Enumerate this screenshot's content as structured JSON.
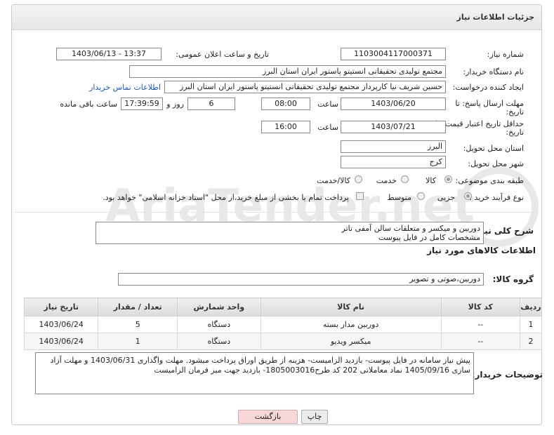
{
  "panel": {
    "title": "جزئیات اطلاعات نیاز"
  },
  "fields": {
    "need_number": {
      "label": "شماره نیاز:",
      "value": "1103004117000371"
    },
    "announce_datetime": {
      "label": "تاریخ و ساعت اعلان عمومی:",
      "value": "1403/06/13 - 13:37"
    },
    "buyer_org": {
      "label": "نام دستگاه خریدار:",
      "value": "مجتمع تولیدی تحقیقاتی انستیتو پاستور ایران استان البرز"
    },
    "requester": {
      "label": "ایجاد کننده درخواست:",
      "value": "حسین شریف نیا کارپرداز مجتمع تولیدی تحقیقاتی انستیتو پاستور ایران استان البرز",
      "contact_link": "اطلاعات تماس خریدار"
    },
    "reply_deadline": {
      "label": "مهلت ارسال پاسخ: تا تاریخ:",
      "date": "1403/06/20",
      "time_label": "ساعت",
      "time": "08:00",
      "days": "6",
      "days_label": "روز و",
      "remaining": "17:39:59",
      "remaining_label": "ساعت باقی مانده"
    },
    "price_validity": {
      "label": "حداقل تاریخ اعتبار قیمت: تا تاریخ:",
      "date": "1403/07/21",
      "time_label": "ساعت",
      "time": "16:00"
    },
    "province": {
      "label": "استان محل تحویل:",
      "value": "البرز"
    },
    "city": {
      "label": "شهر محل تحویل:",
      "value": "کرج"
    },
    "category": {
      "label": "طبقه بندی موضوعی:",
      "options": [
        "کالا",
        "خدمت",
        "کالا/خدمت"
      ]
    },
    "process": {
      "label": "نوع فرآیند خرید :",
      "options": [
        "جزیی",
        "متوسط"
      ],
      "note": "پرداخت تمام یا بخشی از مبلغ خرید،از محل \"اسناد خزانه اسلامی\" خواهد بود."
    }
  },
  "description": {
    "label": "شرح کلی نیاز:",
    "value": "دوربین و میکسر و متعلقات سالن آمفی تاتر\nمشخصات کامل در فایل پیوست"
  },
  "goods_section": {
    "title": "اطلاعات کالاهای مورد نیاز",
    "group_label": "گروه کالا:",
    "group_value": "دوربین،صوتی و تصویر"
  },
  "table": {
    "headers": [
      "ردیف",
      "کد کالا",
      "نام کالا",
      "واحد شمارش",
      "تعداد / مقدار",
      "تاریخ نیاز"
    ],
    "rows": [
      [
        "1",
        "--",
        "دوربین مدار بسته",
        "دستگاه",
        "5",
        "1403/06/24"
      ],
      [
        "2",
        "--",
        "میکسر ویدیو",
        "دستگاه",
        "1",
        "1403/06/24"
      ]
    ]
  },
  "buyer_notes": {
    "label": "توضیحات خریدار:",
    "value": "پیش نیاز سامانه در فایل پیوست- بازدید الزامیست- هزینه از طریق اوراق پرداخت میشود. مهلت واگذاری 1403/06/31 و مهلت آزاد سازی 1405/09/16 نماد معاملاتی 202 کد طرح1805003016- بازدید جهت میز فرمان الزامیست"
  },
  "buttons": {
    "print": "چاپ",
    "back": "بازگشت"
  },
  "watermark": {
    "text": "AriaTender.net"
  }
}
